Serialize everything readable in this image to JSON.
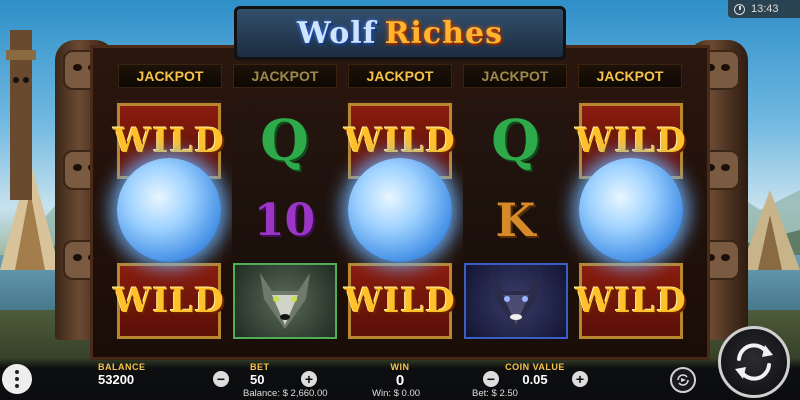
{
  "clock": {
    "time": "13:43"
  },
  "game": {
    "title_part1": "Wolf",
    "title_part2": "Riches"
  },
  "jackpots": [
    "JACKPOT",
    "JACKPOT",
    "JACKPOT",
    "JACKPOT",
    "JACKPOT"
  ],
  "reels": [
    {
      "top": "WILD",
      "mid": "moon-icon",
      "bot": "WILD"
    },
    {
      "top": "Q",
      "mid": "10",
      "bot": "wolf-icon"
    },
    {
      "top": "WILD",
      "mid": "moon-icon",
      "bot": "WILD"
    },
    {
      "top": "Q",
      "mid": "K",
      "bot": "black-wolf-icon"
    },
    {
      "top": "WILD",
      "mid": "moon-icon",
      "bot": "WILD"
    }
  ],
  "hud": {
    "balance_label": "BALANCE",
    "balance_value": "53200",
    "bet_label": "BET",
    "bet_value": "50",
    "win_label": "WIN",
    "win_value": "0",
    "coin_value_label": "COIN VALUE",
    "coin_value": "0.05",
    "minus": "−",
    "plus": "+"
  },
  "footer": {
    "balance": "Balance: $ 2,660.00",
    "win": "Win: $ 0.00",
    "bet": "Bet: $ 2.50"
  },
  "colors": {
    "accent_gold": "#f6c34a",
    "wild_red": "#8a1c0e",
    "moon_blue": "#4b95e8"
  }
}
